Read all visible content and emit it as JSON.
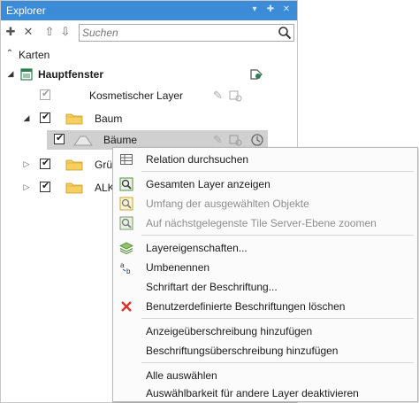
{
  "panel": {
    "title": "Explorer",
    "controls": [
      "▾",
      "✚",
      "✕"
    ]
  },
  "toolbar": {
    "icons": [
      "add-icon",
      "remove-icon",
      "move-up-icon",
      "move-down-icon"
    ],
    "search_placeholder": "Suchen"
  },
  "tree": {
    "section_label": "Karten",
    "map_label": "Hauptfenster",
    "rows": [
      {
        "label": "Kosmetischer Layer"
      },
      {
        "label": "Baum"
      },
      {
        "label": "Bäume"
      },
      {
        "label": "Grü"
      },
      {
        "label": "ALK"
      }
    ]
  },
  "context_menu": {
    "items": [
      {
        "label": "Relation durchsuchen",
        "icon": "table-icon",
        "enabled": true
      },
      {
        "label": "Gesamten Layer anzeigen",
        "icon": "zoom-layer-icon",
        "enabled": true
      },
      {
        "label": "Umfang der ausgewählten Objekte",
        "icon": "zoom-selection-icon",
        "enabled": false
      },
      {
        "label": "Auf nächstgelegenste Tile Server-Ebene zoomen",
        "icon": "zoom-tile-icon",
        "enabled": false
      },
      {
        "label": "Layereigenschaften...",
        "icon": "layers-icon",
        "enabled": true
      },
      {
        "label": "Umbenennen",
        "icon": "rename-icon",
        "enabled": true
      },
      {
        "label": "Schriftart der Beschriftung...",
        "icon": "",
        "enabled": true
      },
      {
        "label": "Benutzerdefinierte Beschriftungen löschen",
        "icon": "delete-icon",
        "enabled": true
      },
      {
        "label": "Anzeigeüberschreibung hinzufügen",
        "icon": "",
        "enabled": true
      },
      {
        "label": "Beschriftungsüberschreibung hinzufügen",
        "icon": "",
        "enabled": true
      },
      {
        "label": "Alle auswählen",
        "icon": "",
        "enabled": true
      },
      {
        "label": "Auswählbarkeit für andere Layer deaktivieren",
        "icon": "",
        "enabled": true
      }
    ]
  },
  "colors": {
    "titlebar": "#3c8bd6",
    "selection": "#d0d0d0",
    "delete": "#d9342b"
  }
}
